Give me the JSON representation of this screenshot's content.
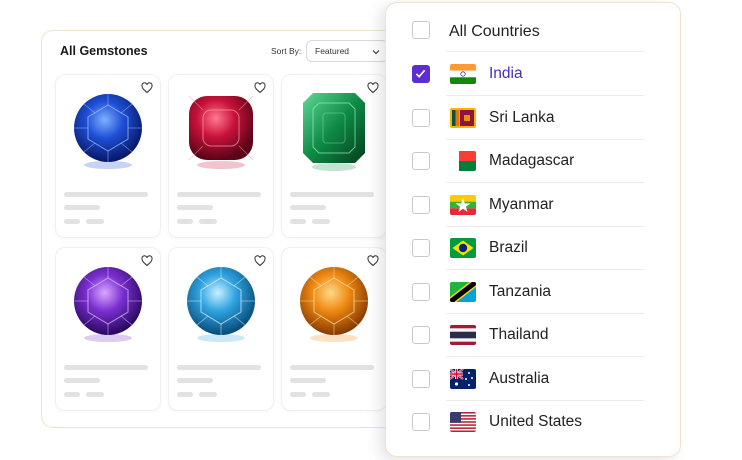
{
  "catalog": {
    "title": "All Gemstones",
    "sort_label": "Sort By:",
    "sort_value": "Featured",
    "products": [
      {
        "gem": "blue-sapphire-icon",
        "color": "#1f4fd6"
      },
      {
        "gem": "ruby-icon",
        "color": "#c8123a"
      },
      {
        "gem": "emerald-icon",
        "color": "#0f8a45"
      },
      {
        "gem": "amethyst-icon",
        "color": "#7a2fd0"
      },
      {
        "gem": "blue-topaz-icon",
        "color": "#2fa3e0"
      },
      {
        "gem": "citrine-icon",
        "color": "#ef8a12"
      }
    ]
  },
  "countries": {
    "all_label": "All Countries",
    "accent": "#5b2dd6",
    "items": [
      {
        "name": "India",
        "checked": true,
        "flag": "india-flag-icon"
      },
      {
        "name": "Sri Lanka",
        "checked": false,
        "flag": "sri-lanka-flag-icon"
      },
      {
        "name": "Madagascar",
        "checked": false,
        "flag": "madagascar-flag-icon"
      },
      {
        "name": "Myanmar",
        "checked": false,
        "flag": "myanmar-flag-icon"
      },
      {
        "name": "Brazil",
        "checked": false,
        "flag": "brazil-flag-icon"
      },
      {
        "name": "Tanzania",
        "checked": false,
        "flag": "tanzania-flag-icon"
      },
      {
        "name": "Thailand",
        "checked": false,
        "flag": "thailand-flag-icon"
      },
      {
        "name": "Australia",
        "checked": false,
        "flag": "australia-flag-icon"
      },
      {
        "name": "United States",
        "checked": false,
        "flag": "united-states-flag-icon"
      }
    ]
  }
}
